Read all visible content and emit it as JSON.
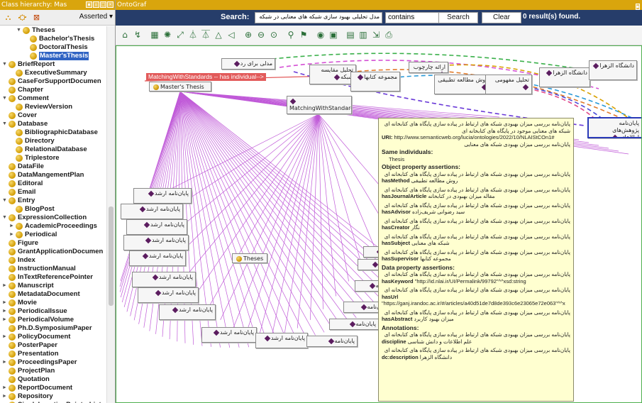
{
  "left_panel": {
    "title": "Class hierarchy: Mas",
    "asserted": "Asserted",
    "tree": [
      {
        "label": "Theses",
        "level": 2,
        "twisty": "▼"
      },
      {
        "label": "Bachelor'sThesis",
        "level": 3,
        "twisty": ""
      },
      {
        "label": "DoctoralThesis",
        "level": 3,
        "twisty": ""
      },
      {
        "label": "Master'sThesis",
        "level": 3,
        "twisty": "",
        "selected": true
      },
      {
        "label": "BriefReport",
        "level": 0,
        "twisty": "▼"
      },
      {
        "label": "ExecutiveSummary",
        "level": 1,
        "twisty": ""
      },
      {
        "label": "CaseForSupportDocumen",
        "level": 0,
        "twisty": ""
      },
      {
        "label": "Chapter",
        "level": 0,
        "twisty": ""
      },
      {
        "label": "Comment",
        "level": 0,
        "twisty": "▼"
      },
      {
        "label": "ReviewVersion",
        "level": 1,
        "twisty": ""
      },
      {
        "label": "Cover",
        "level": 0,
        "twisty": ""
      },
      {
        "label": "Database",
        "level": 0,
        "twisty": "▼"
      },
      {
        "label": "BibliographicDatabase",
        "level": 1,
        "twisty": ""
      },
      {
        "label": "Directory",
        "level": 1,
        "twisty": ""
      },
      {
        "label": "RelationalDatabase",
        "level": 1,
        "twisty": ""
      },
      {
        "label": "Triplestore",
        "level": 1,
        "twisty": ""
      },
      {
        "label": "DataFile",
        "level": 0,
        "twisty": ""
      },
      {
        "label": "DataMangementPlan",
        "level": 0,
        "twisty": ""
      },
      {
        "label": "Editoral",
        "level": 0,
        "twisty": ""
      },
      {
        "label": "Email",
        "level": 0,
        "twisty": ""
      },
      {
        "label": "Entry",
        "level": 0,
        "twisty": "▼"
      },
      {
        "label": "BlogPost",
        "level": 1,
        "twisty": ""
      },
      {
        "label": "ExpressionCollection",
        "level": 0,
        "twisty": "▼"
      },
      {
        "label": "AcademicProceedings",
        "level": 1,
        "twisty": "►"
      },
      {
        "label": "Periodical",
        "level": 1,
        "twisty": "►"
      },
      {
        "label": "Figure",
        "level": 0,
        "twisty": ""
      },
      {
        "label": "GrantApplicationDocumen",
        "level": 0,
        "twisty": ""
      },
      {
        "label": "Index",
        "level": 0,
        "twisty": ""
      },
      {
        "label": "InstructionManual",
        "level": 0,
        "twisty": ""
      },
      {
        "label": "InTextReferencePointer",
        "level": 0,
        "twisty": ""
      },
      {
        "label": "Manuscript",
        "level": 0,
        "twisty": "►"
      },
      {
        "label": "MetadataDocument",
        "level": 0,
        "twisty": ""
      },
      {
        "label": "Movie",
        "level": 0,
        "twisty": "►"
      },
      {
        "label": "PeriodicalIssue",
        "level": 0,
        "twisty": "►"
      },
      {
        "label": "PeriodicalVolume",
        "level": 0,
        "twisty": "►"
      },
      {
        "label": "Ph.D.SymposiumPaper",
        "level": 0,
        "twisty": ""
      },
      {
        "label": "PolicyDocument",
        "level": 0,
        "twisty": "►"
      },
      {
        "label": "PosterPaper",
        "level": 0,
        "twisty": ""
      },
      {
        "label": "Presentation",
        "level": 0,
        "twisty": ""
      },
      {
        "label": "ProceedingsPaper",
        "level": 0,
        "twisty": "►"
      },
      {
        "label": "ProjectPlan",
        "level": 0,
        "twisty": ""
      },
      {
        "label": "Quotation",
        "level": 0,
        "twisty": ""
      },
      {
        "label": "ReportDocument",
        "level": 0,
        "twisty": "►"
      },
      {
        "label": "Repository",
        "level": 0,
        "twisty": "►"
      },
      {
        "label": "SingleLocationPointerList",
        "level": 0,
        "twisty": ""
      }
    ]
  },
  "right_panel": {
    "title": "OntoGraf",
    "search_label": "Search:",
    "search_value": "مدل تحلیلی بهبود سازی شبکه های معنایی در شبکه",
    "search_mode": "contains",
    "search_button": "Search",
    "clear_button": "Clear",
    "result_text": "0 result(s) found."
  },
  "graph": {
    "edge_label": "MatchingWithStandards -- has individual-->",
    "nodes": {
      "masters_thesis": "Master's Thesis",
      "matching": "MatchingWithStandards",
      "theses": "Theses",
      "top1": "مدلی برای رد",
      "top2": "تحلیل مقایسه شبکه",
      "top3": "مجموعه کتابها",
      "top4": "ارائه چارچوب",
      "top5": "روش مطالعه تطبیقی",
      "top6": "دانشگاه الزهرا",
      "top7": "تحلیل مفهومی",
      "sel": "پایان‌نامه پژوهش‌های اطلاعاتی",
      "left1": "پایان‌نامه ارشد",
      "left2": "پایان‌نامه ارشد",
      "left3": "پایان‌نامه ارشد",
      "left4": "پایان‌نامه ارشد",
      "right1": "پایان‌نامه",
      "right2": "پایان‌نامه",
      "bottom1": "پایان‌نامه ارشد"
    }
  },
  "tooltip": {
    "title_line": "پایان‌نامه بررسی میزان بهبودی شبکه های ارتباط در پیاده سازی پایگاه های کتابخانه ای",
    "title_line2": "شبکه های معنایی موجود در پایگاه های کتابخانه ای",
    "uri_label": "URI:",
    "uri": "http://www.semanticweb.org/lucia/ontologies/2022/10/NLAIStCOn1#",
    "uri_tail": "پایان‌نامه بررسی میزان بهبودی شبکه های معنایی",
    "same_header": "Same individuals:",
    "same_value": "Thesis",
    "obj_header": "Object property assertions:",
    "obj_rows": [
      {
        "prop": "hasMethod",
        "value": "روش مطالعه تطبیقی"
      },
      {
        "prop": "hasJournalArticle",
        "value": "مقاله میزان بهبودی در کتابخانه"
      },
      {
        "prop": "hasAdvisor",
        "value": "سید رضوانی شریف‌زاده"
      },
      {
        "prop": "hasCreator",
        "value": "نگار"
      },
      {
        "prop": "hasSubject",
        "value": "شبکه های معنایی"
      },
      {
        "prop": "hasSupervisor",
        "value": "مجموعه کتابها"
      }
    ],
    "data_header": "Data property assertions:",
    "data_rows": [
      {
        "prop": "hasKeyword",
        "value": "\"http://id.nlai.ir/UI/Permalink/99792\"^^xsd:string"
      },
      {
        "prop": "hasUrl",
        "value": "\"https://ganj.irandoc.ac.ir/#/articles/a40d51de7d8de393c6e23065e72e063\"^^x"
      },
      {
        "prop": "hasAbstract",
        "value": "میزان بهبود کاربرد"
      }
    ],
    "ann_header": "Annotations:",
    "ann_rows": [
      {
        "prop": "discipline",
        "value": "علم اطلاعات و دانش شناسی"
      },
      {
        "prop": "dc:description",
        "value": "دانشگاه الزهرا"
      }
    ]
  },
  "colors": {
    "title_bar": "#d9a50d",
    "search_bar": "#263d6a",
    "edge_purple": "#c05ad8",
    "tooltip_bg": "#ffffd0"
  }
}
